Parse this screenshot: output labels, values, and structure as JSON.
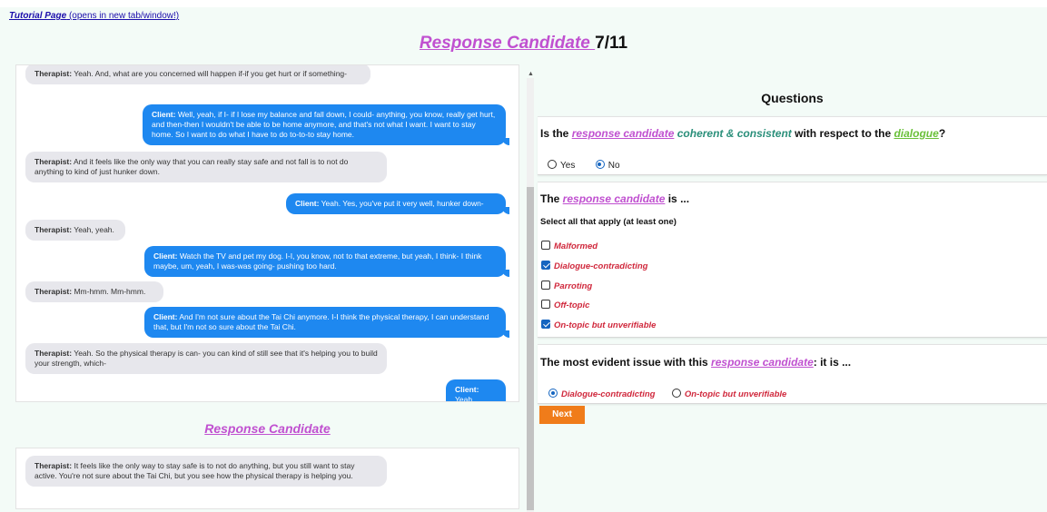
{
  "header": {
    "tutorial_link": "Tutorial Page",
    "tutorial_suffix": " (opens in new tab/window!)",
    "title_link": "Response Candidate ",
    "counter": "7/11"
  },
  "dialogue": [
    {
      "speaker": "Therapist:",
      "text": " Yeah. And, what are you concerned will happen if-if you get hurt or if something-"
    },
    {
      "speaker": "Client:",
      "text": " Well, yeah, if I- if I lose my balance and fall down, I could- anything, you know, really get hurt, and then-then I wouldn't be able to be home anymore, and that's not what I want. I want to stay home. So I want to do what I have to do to-to-to stay home."
    },
    {
      "speaker": "Therapist:",
      "text": " And it feels like the only way that you can really stay safe and not fall is to not do anything to kind of just hunker down."
    },
    {
      "speaker": "Client:",
      "text": " Yeah. Yes, you've put it very well, hunker down-"
    },
    {
      "speaker": "Therapist:",
      "text": " Yeah, yeah."
    },
    {
      "speaker": "Client:",
      "text": " Watch the TV and pet my dog. I-I, you know, not to that extreme, but yeah, I think- I think maybe, um, yeah, I was-was going- pushing too hard."
    },
    {
      "speaker": "Therapist:",
      "text": " Mm-hmm. Mm-hmm."
    },
    {
      "speaker": "Client:",
      "text": " And I'm not sure about the Tai Chi anymore. I-I think the physical therapy, I can understand that, but I'm not so sure about the Tai Chi."
    },
    {
      "speaker": "Therapist:",
      "text": " Yeah. So the physical therapy is can- you can kind of still see that it's helping you to build your strength, which-"
    },
    {
      "speaker": "Client:",
      "text": " Yeah."
    }
  ],
  "response_candidate": {
    "heading": "Response Candidate",
    "speaker": "Therapist:",
    "text": " It feels like the only way to stay safe is to not do anything, but you still want to stay active. You're not sure about the Tai Chi, but you see how the physical therapy is helping you."
  },
  "questions": {
    "heading": "Questions",
    "q1": {
      "pre": "Is the ",
      "rc": "response candidate",
      "mid": "coherent & consistent",
      "post": " with respect to the ",
      "dialogue": "dialogue",
      "end": "?",
      "options": [
        {
          "label": "Yes",
          "selected": false
        },
        {
          "label": "No",
          "selected": true
        }
      ]
    },
    "q2": {
      "pre": "The ",
      "rc": "response candidate",
      "post": " is ...",
      "instruction": "Select all that apply (at least one)",
      "options": [
        {
          "label": "Malformed",
          "checked": false
        },
        {
          "label": "Dialogue-contradicting",
          "checked": true
        },
        {
          "label": "Parroting",
          "checked": false
        },
        {
          "label": "Off-topic",
          "checked": false
        },
        {
          "label": "On-topic but unverifiable",
          "checked": true
        }
      ]
    },
    "q3": {
      "pre": "The most evident issue with this ",
      "rc": "response candidate",
      "post": ": it is ...",
      "options": [
        {
          "label": "Dialogue-contradicting",
          "selected": true
        },
        {
          "label": "On-topic but unverifiable",
          "selected": false
        }
      ]
    }
  },
  "next_button": "Next",
  "colors": {
    "accent_pink": "#c050d0",
    "client_bubble": "#1e88f0",
    "therapist_bubble": "#e7e7ec",
    "option_red": "#d0283c",
    "next_orange": "#f07c1a",
    "page_bg": "#f3fbf7"
  }
}
